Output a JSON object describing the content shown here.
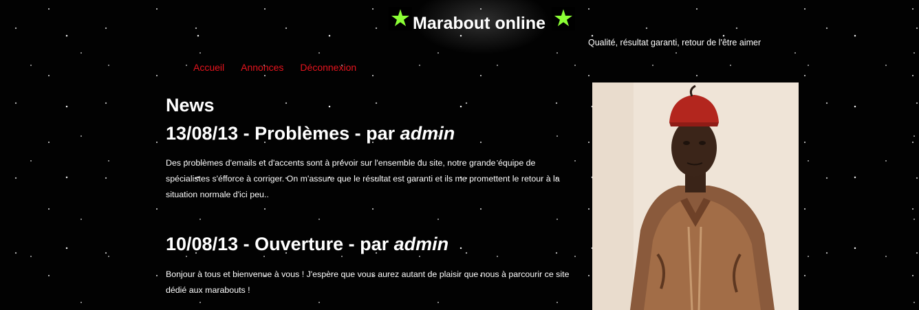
{
  "header": {
    "title": "Marabout online",
    "tagline": "Qualité, résultat garanti, retour de l'être aimer",
    "star_icon": "★",
    "star_color": "#8bff35"
  },
  "nav": {
    "items": [
      {
        "label": "Accueil"
      },
      {
        "label": "Annonces"
      },
      {
        "label": "Déconnexion"
      }
    ],
    "link_color": "#e8141e"
  },
  "main": {
    "heading": "News",
    "posts": [
      {
        "title": "13/08/13 - Problèmes - par ",
        "author": "admin",
        "body": "Des problèmes d'emails et d'accents sont à prévoir sur l'ensemble du site, notre grande équipe de spécialistes s'éfforce à corriger. On m'assure que le résultat est garanti et ils me promettent le retour à la situation normale d'ici peu.."
      },
      {
        "title": "10/08/13 - Ouverture - par ",
        "author": "admin",
        "body": "Bonjour à tous et bienvenue à vous ! J'espère que vous aurez autant de plaisir que nous à parcourir ce site dédié aux marabouts !"
      }
    ]
  },
  "sidebar": {
    "photo": "portrait of a man in a red fez and brown embroidered robe"
  }
}
